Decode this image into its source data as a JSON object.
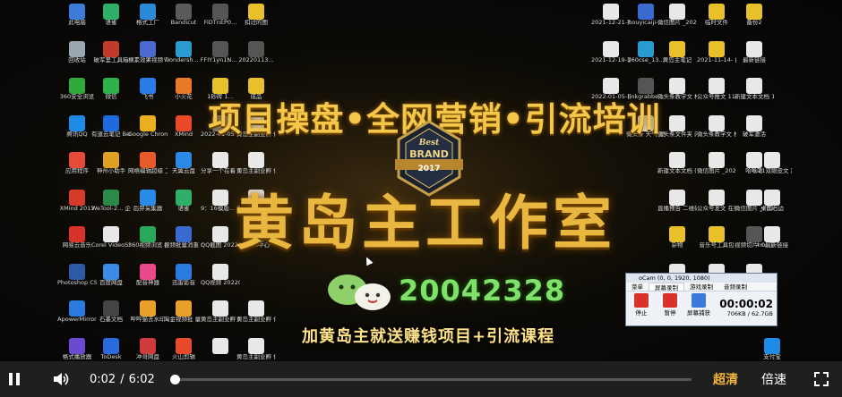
{
  "desktop": {
    "columns": [
      {
        "icons": [
          {
            "label": "此电脑",
            "color": "#3d7bd9"
          },
          {
            "label": "回收站",
            "color": "#9ba6b3"
          },
          {
            "label": "360安全浏览",
            "color": "#2eaa3a"
          },
          {
            "label": "腾讯QQ",
            "color": "#1e8ce6"
          },
          {
            "label": "应用程序",
            "color": "#e84a3a"
          },
          {
            "label": "XMind 2013",
            "color": "#d83a2a"
          },
          {
            "label": "网易云音乐",
            "color": "#d8322a"
          },
          {
            "label": "Photoshop CS4",
            "color": "#2a5aa8"
          },
          {
            "label": "ApowerMirror",
            "color": "#2a7ae0"
          },
          {
            "label": "格式播放器",
            "color": "#6a4ad0"
          }
        ]
      },
      {
        "icons": [
          {
            "label": "语雀",
            "color": "#2fb069"
          },
          {
            "label": "破军里工具箱",
            "color": "#c23a2a"
          },
          {
            "label": "微信",
            "color": "#2db14a"
          },
          {
            "label": "有道云笔记 Beta版",
            "color": "#1e6be0"
          },
          {
            "label": "神州小助手",
            "color": "#e0a020"
          },
          {
            "label": "WeTool-2... 企业离线...",
            "color": "#2a8a4a"
          },
          {
            "label": "Corel VideoStud...",
            "color": "#e8e8e8"
          },
          {
            "label": "百度网盘",
            "color": "#3a8ae8"
          },
          {
            "label": "石墨文档",
            "color": "#444"
          },
          {
            "label": "ToDesk",
            "color": "#2a6ae0"
          }
        ]
      },
      {
        "icons": [
          {
            "label": "格式工厂",
            "color": "#2a8ad8"
          },
          {
            "label": "横素效果视频 下载(xmlbar)",
            "color": "#4a6ad0"
          },
          {
            "label": "飞书",
            "color": "#2a7ae8"
          },
          {
            "label": "Google Chrome",
            "color": "#e8b020"
          },
          {
            "label": "网络编辑超级 工具箱",
            "color": "#e85a2a"
          },
          {
            "label": "后羿采集器",
            "color": "#2a8ae8"
          },
          {
            "label": "360视频浏览 器",
            "color": "#2aa85a"
          },
          {
            "label": "配音神器",
            "color": "#e84a8a"
          },
          {
            "label": "哔哔猫去水印",
            "color": "#e8a02a"
          },
          {
            "label": "冲哥网盘",
            "color": "#d03a3a"
          }
        ]
      },
      {
        "icons": [
          {
            "label": "Bandicut",
            "color": "#5a5a5a"
          },
          {
            "label": "Wondersh... Filmora9",
            "color": "#2a9ad0"
          },
          {
            "label": "小火花",
            "color": "#e87a2a"
          },
          {
            "label": "XMind",
            "color": "#e84a2a"
          },
          {
            "label": "天翼云盘",
            "color": "#2a8ae8"
          },
          {
            "label": "语雀",
            "color": "#2fb069"
          },
          {
            "label": "视频批量消重 new",
            "color": "#3a6ad0"
          },
          {
            "label": "迅雷影音",
            "color": "#2a7ae0"
          },
          {
            "label": "淘金视频批 量下载3.0",
            "color": "#e8a02a"
          },
          {
            "label": "火山剪辑",
            "color": "#e84a2a"
          }
        ]
      },
      {
        "icons": [
          {
            "label": "FiDTnEP0...",
            "color": "#555"
          },
          {
            "label": "FIY1yn1N...",
            "color": "#555"
          },
          {
            "label": "1砂砖 1...",
            "color": "#e8c02a"
          },
          {
            "label": "2022-01-05 122512",
            "color": "#777"
          },
          {
            "label": "分享一个在着 节能刚刚好...",
            "color": "#e8e8e8"
          },
          {
            "label": "9：16模版... 享一个在着",
            "color": "#e8e8e8"
          },
          {
            "label": "QQ截图 20220113...",
            "color": "#e8e8e8"
          },
          {
            "label": "QQ视频 20220113...",
            "color": "#e8e8e8"
          },
          {
            "label": "黄岛主副业孵 化基地",
            "color": "#e8e8e8"
          },
          {
            "label": "",
            "color": "#e8e8e8"
          }
        ]
      },
      {
        "icons": [
          {
            "label": "扣过的图",
            "color": "#e8c02a"
          },
          {
            "label": "20220113...",
            "color": "#555"
          },
          {
            "label": "成品",
            "color": "#e8c02a"
          },
          {
            "label": "黄岛主副业孵 化社群",
            "color": "#e8e8e8"
          },
          {
            "label": "黄岛主副业孵 化社群",
            "color": "#e8e8e8"
          },
          {
            "label": "",
            "color": "#e8e8e8"
          },
          {
            "label": "Flash中心",
            "color": "#3a6ad0"
          },
          {
            "label": "",
            "color": "#000"
          },
          {
            "label": "黄岛主副业孵 化基地",
            "color": "#e8e8e8"
          },
          {
            "label": "黄岛主副业孵 化基地",
            "color": "#e8e8e8"
          }
        ]
      },
      {
        "icons": [
          {
            "label": "2021-12-21-科普中视频...",
            "color": "#e8e8e8"
          },
          {
            "label": "2021-12-19-影子视频号",
            "color": "#e8e8e8"
          },
          {
            "label": "2022-01-05-视频...",
            "color": "#e8e8e8"
          },
          {
            "label": "",
            "color": "#000"
          },
          {
            "label": "",
            "color": "#000"
          },
          {
            "label": "",
            "color": "#000"
          },
          {
            "label": "",
            "color": "#000"
          },
          {
            "label": "",
            "color": "#000"
          },
          {
            "label": "",
            "color": "#000"
          },
          {
            "label": "",
            "color": "#000"
          }
        ]
      },
      {
        "icons": [
          {
            "label": "houyicaiji-...",
            "color": "#3a6ad0"
          },
          {
            "label": "360cse_13...",
            "color": "#2a9ad0"
          },
          {
            "label": "linkgrabbe...",
            "color": "#555"
          },
          {
            "label": "微头条 天气 预报(cctv)",
            "color": "#e8e8e8"
          },
          {
            "label": "",
            "color": "#000"
          },
          {
            "label": "",
            "color": "#000"
          },
          {
            "label": "",
            "color": "#000"
          },
          {
            "label": "",
            "color": "#000"
          },
          {
            "label": "",
            "color": "#000"
          },
          {
            "label": "",
            "color": "#000"
          }
        ]
      },
      {
        "icons": [
          {
            "label": "微信图片 _2021110...",
            "color": "#e8e8e8"
          },
          {
            "label": "黄岛主笔记",
            "color": "#e8c02a"
          },
          {
            "label": "微头条教学文 档",
            "color": "#e8e8e8"
          },
          {
            "label": "微头条文件夹 内",
            "color": "#e8e8e8"
          },
          {
            "label": "新建文本文档 (2)",
            "color": "#e8e8e8"
          },
          {
            "label": "直播预告 二维码",
            "color": "#e8e8e8"
          },
          {
            "label": "杂物",
            "color": "#e8c02a"
          },
          {
            "label": "MDS",
            "color": "#e8e8e8"
          },
          {
            "label": "",
            "color": "#000"
          },
          {
            "label": "",
            "color": "#000"
          }
        ]
      },
      {
        "icons": [
          {
            "label": "临时文件",
            "color": "#e8c02a"
          },
          {
            "label": "2021-11-14- 自媒体直局...",
            "color": "#e8c02a"
          },
          {
            "label": "公众号推文 11.14...",
            "color": "#e8e8e8"
          },
          {
            "label": "微头条教学文 档",
            "color": "#e8e8e8"
          },
          {
            "label": "微信图片 _2021111...",
            "color": "#e8e8e8"
          },
          {
            "label": "公众号发文 在线内容",
            "color": "#e8e8e8"
          },
          {
            "label": "音乐号工具包",
            "color": "#e8c02a"
          },
          {
            "label": "转音频自媒...",
            "color": "#e8e8e8"
          },
          {
            "label": "",
            "color": "#000"
          },
          {
            "label": "",
            "color": "#000"
          }
        ]
      },
      {
        "icons": [
          {
            "label": "备份2",
            "color": "#e8c02a"
          },
          {
            "label": "最新链接",
            "color": "#e8e8e8"
          },
          {
            "label": "新建文本文档 11.14...",
            "color": "#e8e8e8"
          },
          {
            "label": "破军激活",
            "color": "#e8e8e8"
          },
          {
            "label": "哈哈哈",
            "color": "#e8e8e8"
          },
          {
            "label": "微信图片 _2021111...",
            "color": "#e8e8e8"
          },
          {
            "label": "视频切片mv 工具 Setu...",
            "color": "#555"
          },
          {
            "label": "工具",
            "color": "#e8e8e8"
          },
          {
            "label": "头条",
            "color": "#e8e8e8"
          },
          {
            "label": "",
            "color": "#000"
          }
        ]
      },
      {
        "icons": [
          {
            "label": "",
            "color": "#000"
          },
          {
            "label": "",
            "color": "#000"
          },
          {
            "label": "",
            "color": "#000"
          },
          {
            "label": "",
            "color": "#000"
          },
          {
            "label": "6.21双眼皮文 案2",
            "color": "#e8e8e8"
          },
          {
            "label": "桌面右边",
            "color": "#e8e8e8"
          },
          {
            "label": "4.0最新链接",
            "color": "#e8e8e8"
          },
          {
            "label": "",
            "color": "#000"
          },
          {
            "label": "",
            "color": "#000"
          },
          {
            "label": "支付宝",
            "color": "#1e8ce6"
          }
        ]
      }
    ]
  },
  "promo": {
    "headline": "项目操盘•全网营销•引流培训",
    "badge_best": "Best",
    "badge_brand": "BRAND",
    "badge_year": "2017",
    "studio": "黄岛主工作室",
    "qq_number": "20042328",
    "subline": "加黄岛主就送赚钱项目+引流课程"
  },
  "ocam": {
    "title": "oCam (0, 0, 1920, 1080)",
    "tabs": [
      "菜单",
      "屏幕录制",
      "游戏录制",
      "音频录制"
    ],
    "active_tab": 1,
    "tools": [
      {
        "label": "停止",
        "color": "#d8322a"
      },
      {
        "label": "暂停",
        "color": "#d8322a"
      },
      {
        "label": "屏幕捕获",
        "color": "#3a7ad8"
      }
    ],
    "elapsed": "00:00:02",
    "size": "706KB / 62.7GB"
  },
  "player": {
    "current_time": "0:02",
    "separator": "/",
    "duration": "6:02",
    "progress_fraction": 0.0055,
    "quality_label": "超清",
    "speed_label": "倍速",
    "accent_color": "#f0b53a"
  }
}
